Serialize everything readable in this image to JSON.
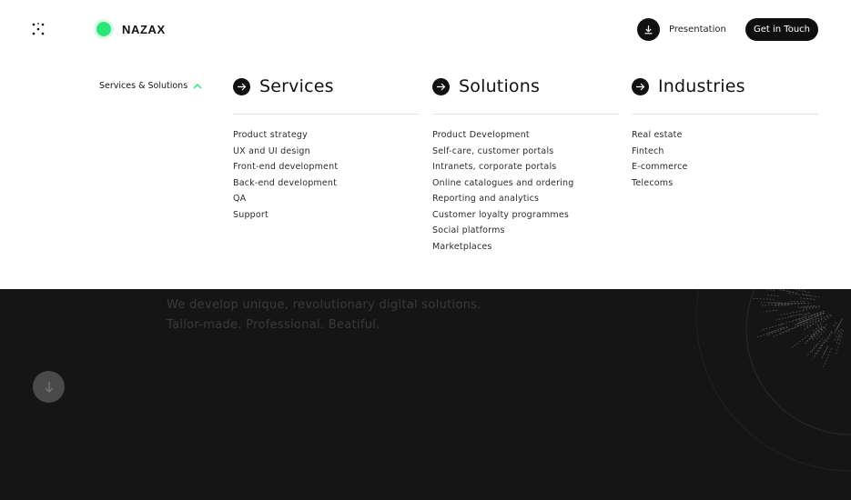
{
  "header": {
    "brand_name": "NAZAX",
    "presentation_label": "Presentation",
    "cta_label": "Get in Touch"
  },
  "nav": {
    "toggle_label": "Services & Solutions"
  },
  "columns": [
    {
      "title": "Services",
      "items": [
        "Product strategy",
        "UX and UI design",
        "Front-end development",
        "Back-end development",
        "QA",
        "Support"
      ]
    },
    {
      "title": "Solutions",
      "items": [
        "Product Development",
        "Self-care, customer portals",
        "Intranets, corporate portals",
        "Online catalogues and ordering",
        "Reporting and analytics",
        "Customer loyalty programmes",
        "Social platforms",
        "Marketplaces"
      ]
    },
    {
      "title": "Industries",
      "items": [
        "Real estate",
        "Fintech",
        "E-commerce",
        "Telecoms"
      ]
    }
  ],
  "hero": {
    "line1": "We develop unique, revolutionary digital solutions.",
    "line2": "Tailor-made. Professional. Beatiful."
  },
  "colors": {
    "accent_green": "#2ee57a",
    "dark_bg": "#151515",
    "menu_bg": "#ffffff"
  },
  "icons": {
    "logo": "dots-logo-icon",
    "download": "download-icon",
    "chevron": "chevron-up-icon",
    "arrow": "arrow-right-icon",
    "scroll": "arrow-down-icon"
  }
}
